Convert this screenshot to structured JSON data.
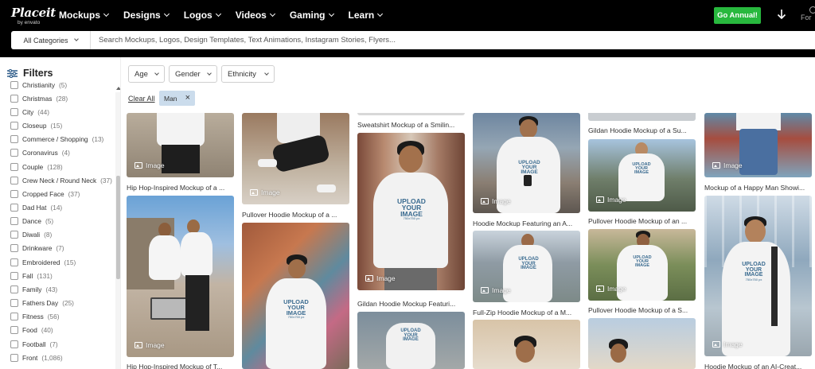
{
  "header": {
    "logo": "Placeit",
    "logo_sub": "by envato",
    "nav": [
      "Mockups",
      "Designs",
      "Logos",
      "Videos",
      "Gaming",
      "Learn"
    ],
    "cta": "Go Annual!",
    "edge_text": "For",
    "search": {
      "category": "All Categories",
      "placeholder": "Search Mockups, Logos, Design Templates, Text Animations, Instagram Stories, Flyers..."
    }
  },
  "sidebar": {
    "title": "Filters",
    "items": [
      {
        "label": "Christianity",
        "count": "(5)"
      },
      {
        "label": "Christmas",
        "count": "(28)"
      },
      {
        "label": "City",
        "count": "(44)"
      },
      {
        "label": "Closeup",
        "count": "(15)"
      },
      {
        "label": "Commerce / Shopping",
        "count": "(13)"
      },
      {
        "label": "Coronavirus",
        "count": "(4)"
      },
      {
        "label": "Couple",
        "count": "(128)"
      },
      {
        "label": "Crew Neck / Round Neck",
        "count": "(37)"
      },
      {
        "label": "Cropped Face",
        "count": "(37)"
      },
      {
        "label": "Dad Hat",
        "count": "(14)"
      },
      {
        "label": "Dance",
        "count": "(5)"
      },
      {
        "label": "Diwali",
        "count": "(8)"
      },
      {
        "label": "Drinkware",
        "count": "(7)"
      },
      {
        "label": "Embroidered",
        "count": "(15)"
      },
      {
        "label": "Fall",
        "count": "(131)"
      },
      {
        "label": "Family",
        "count": "(43)"
      },
      {
        "label": "Fathers Day",
        "count": "(25)"
      },
      {
        "label": "Fitness",
        "count": "(56)"
      },
      {
        "label": "Food",
        "count": "(40)"
      },
      {
        "label": "Football",
        "count": "(7)"
      },
      {
        "label": "Front",
        "count": "(1,086)"
      }
    ]
  },
  "filters": {
    "dropdowns": [
      "Age",
      "Gender",
      "Ethnicity"
    ],
    "clear_all": "Clear All",
    "chip": "Man"
  },
  "gallery": {
    "image_label": "Image",
    "mockup_text": {
      "line1": "UPLOAD",
      "line2": "YOUR",
      "line3": "IMAGE",
      "size": "750x750 px"
    },
    "captions": [
      "Hip Hop-Inspired Mockup of a ...",
      "Hip Hop-Inspired Mockup of T...",
      "Pullover Hoodie Mockup of a ...",
      "Sweatshirt Mockup of a Smilin...",
      "Gildan Hoodie Mockup Featuri...",
      "Hoodie Mockup Featuring an A...",
      "Full-Zip Hoodie Mockup of a M...",
      "Gildan Hoodie Mockup of a Su...",
      "Pullover Hoodie Mockup of an ...",
      "Pullover Hoodie Mockup of a S...",
      "Mockup of a Happy Man Showi...",
      "Hoodie Mockup of an AI-Creat..."
    ]
  },
  "colors": {
    "header_bg": "#000000",
    "cta_green": "#28b83e",
    "chip_bg": "#cbdcec"
  }
}
